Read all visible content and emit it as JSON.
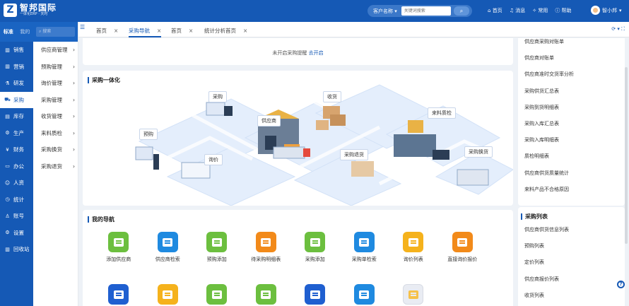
{
  "brand": {
    "name": "智邦国际",
    "tagline": "一体化ERP · 天时"
  },
  "search": {
    "select_label": "客户名称",
    "placeholder": "关键词搜索"
  },
  "top_nav": [
    "首页",
    "消息",
    "常用",
    "帮助"
  ],
  "user": {
    "name": "智小邦"
  },
  "side_head": {
    "tab1": "标准",
    "tab2": "我的"
  },
  "side_search_placeholder": "搜索",
  "main_nav": [
    {
      "label": "销售",
      "icon": "chart-bar-icon"
    },
    {
      "label": "营销",
      "icon": "chart-bar-icon"
    },
    {
      "label": "研发",
      "icon": "flask-icon"
    },
    {
      "label": "采购",
      "icon": "cart-icon"
    },
    {
      "label": "库存",
      "icon": "warehouse-icon"
    },
    {
      "label": "生产",
      "icon": "factory-icon"
    },
    {
      "label": "财务",
      "icon": "yuan-icon"
    },
    {
      "label": "办公",
      "icon": "briefcase-icon"
    },
    {
      "label": "人资",
      "icon": "people-icon"
    },
    {
      "label": "统计",
      "icon": "clock-icon"
    },
    {
      "label": "账号",
      "icon": "person-icon"
    },
    {
      "label": "设置",
      "icon": "gear-icon"
    },
    {
      "label": "回收站",
      "icon": "trash-icon"
    }
  ],
  "sub_nav": [
    "供应商管理",
    "预购管理",
    "询价管理",
    "采购管理",
    "收货管理",
    "来料质检",
    "采购换货",
    "采购退货"
  ],
  "tabs": [
    "首页",
    "采购导航",
    "首页",
    "统计分析首页"
  ],
  "notice": {
    "text": "未开启采购提醒",
    "link": "去开启"
  },
  "flow": {
    "title": "采购一体化",
    "labels": [
      "采购",
      "收货",
      "供应商",
      "来料质检",
      "预购",
      "询价",
      "采购退货",
      "采购换货"
    ]
  },
  "my_nav": {
    "title": "我的导航",
    "items": [
      {
        "label": "添加供应商",
        "color": "#6cbf3f"
      },
      {
        "label": "供应商检索",
        "color": "#1f8ae0"
      },
      {
        "label": "预购添加",
        "color": "#6cbf3f"
      },
      {
        "label": "待采购明细表",
        "color": "#f28a1a"
      },
      {
        "label": "采购添加",
        "color": "#6cbf3f"
      },
      {
        "label": "采购单检索",
        "color": "#1f8ae0"
      },
      {
        "label": "询价列表",
        "color": "#f5b21c"
      },
      {
        "label": "直接询价报价",
        "color": "#f28a1a"
      }
    ],
    "row2_colors": [
      "#1f5fd0",
      "#f5b21c",
      "#6cbf3f",
      "#6cbf3f",
      "#1f5fd0",
      "#1f8ae0",
      "#e9ecf3"
    ]
  },
  "reports": [
    "供应商采购对账单",
    "供应商对账单",
    "供应商准时交货率分析",
    "采购供货汇总表",
    "采购到货明细表",
    "采购入库汇总表",
    "采购入库明细表",
    "质检明细表",
    "供应商供货质量统计",
    "来料产品不合格原因"
  ],
  "purchase_list": {
    "title": "采购列表",
    "items": [
      "供应商供货信息列表",
      "预购列表",
      "定价列表",
      "供应商报价列表",
      "收货列表"
    ]
  },
  "colors": {
    "primary": "#1559b5",
    "page_bg": "#eef2f7"
  }
}
